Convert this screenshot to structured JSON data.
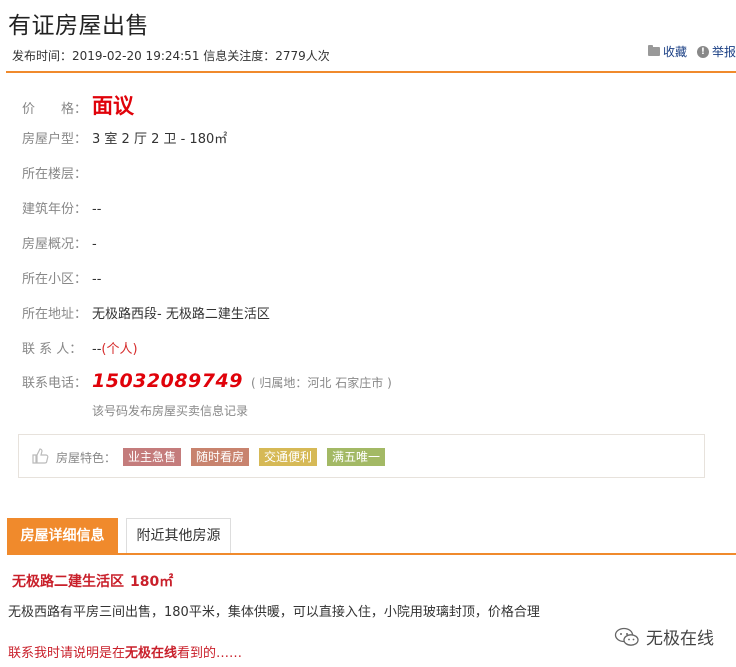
{
  "header": {
    "title": "有证房屋出售",
    "meta": "发布时间：2019-02-20 19:24:51 信息关注度：2779人次",
    "favorite": "收藏",
    "report": "举报"
  },
  "details": {
    "price_label": "价　　格：",
    "price": "面议",
    "layout_label": "房屋户型：",
    "layout": "3 室 2 厅 2 卫 - 180㎡",
    "floor_label": "所在楼层：",
    "floor": "",
    "year_label": "建筑年份：",
    "year": "--",
    "overview_label": "房屋概况：",
    "overview": "-",
    "community_label": "所在小区：",
    "community": "--",
    "address_label": "所在地址：",
    "address": "无极路西段- 无极路二建生活区",
    "contact_label": "联 系 人：",
    "contact": "--",
    "contact_type": "(个人)",
    "phone_label": "联系电话：",
    "phone": "15032089749",
    "phone_origin": "( 归属地：河北 石家庄市 )",
    "phone_records": "该号码发布房屋买卖信息记录"
  },
  "features": {
    "label": "房屋特色：",
    "tags": [
      {
        "text": "业主急售",
        "color": "#c47c7c"
      },
      {
        "text": "随时看房",
        "color": "#c8836e"
      },
      {
        "text": "交通便利",
        "color": "#d6b956"
      },
      {
        "text": "满五唯一",
        "color": "#a3b965"
      }
    ]
  },
  "tabs": {
    "active": "房屋详细信息",
    "other": "附近其他房源"
  },
  "detail": {
    "title": "无极路二建生活区",
    "area": "180㎡",
    "description": "无极西路有平房三间出售，180平米，集体供暖，可以直接入住，小院用玻璃封顶，价格合理",
    "note_prefix": "联系我时请说明是在",
    "note_site": "无极在线",
    "note_suffix": "看到的……"
  },
  "watermark": {
    "text": "无极在线"
  },
  "colors": {
    "accent": "#f08a2c",
    "price_red": "#e0020a",
    "link_blue": "#1a3f84"
  }
}
